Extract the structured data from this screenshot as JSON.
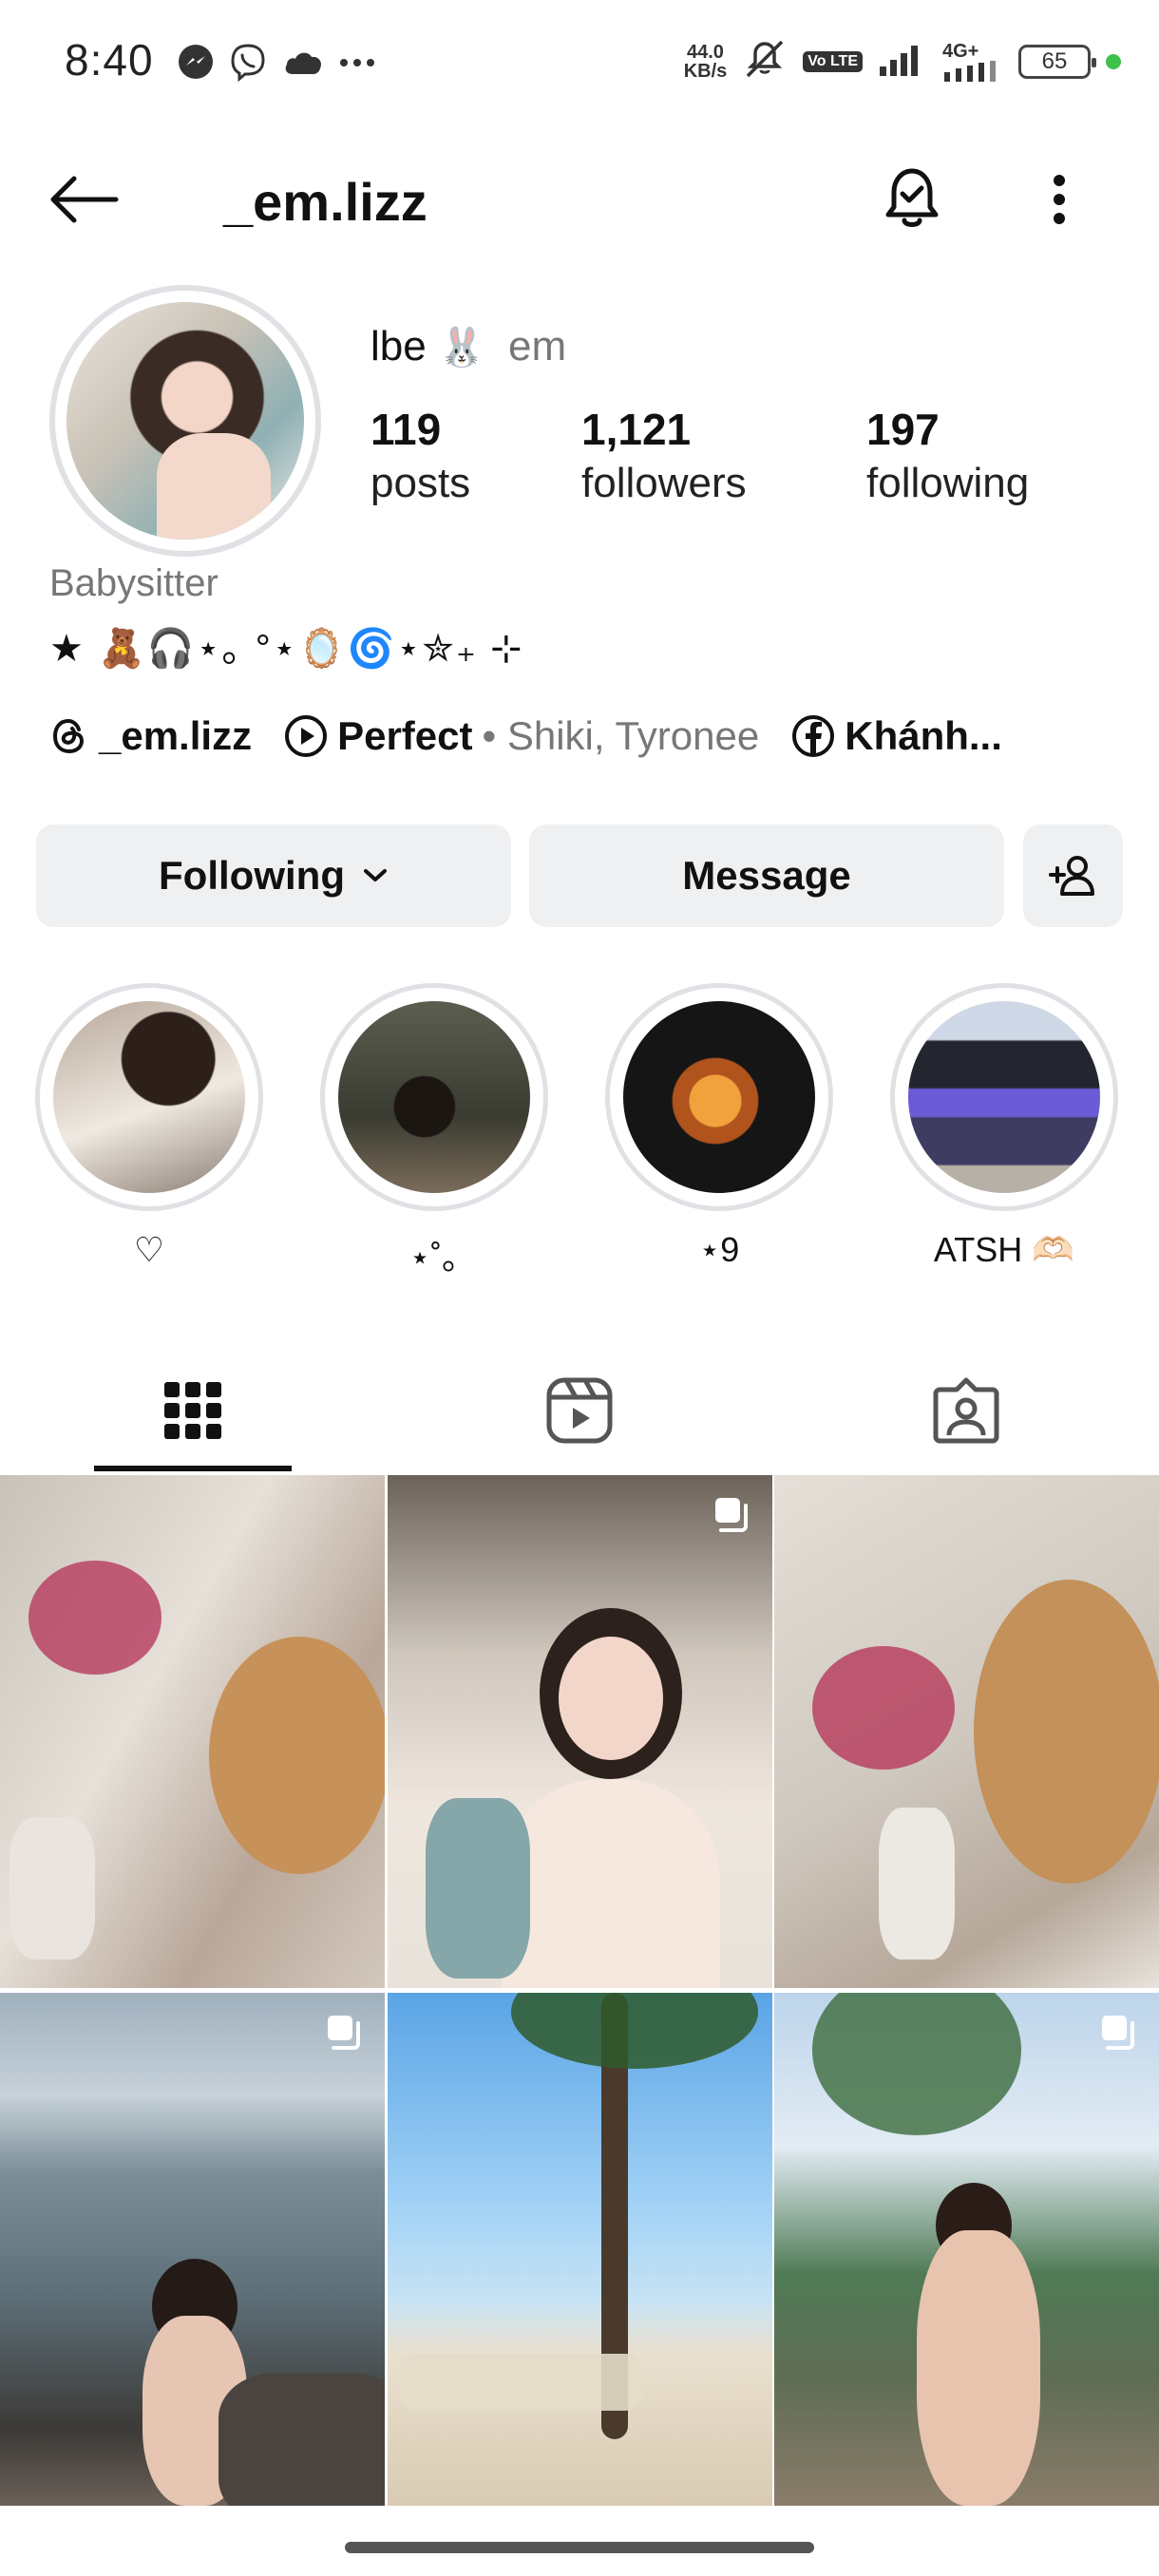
{
  "status_bar": {
    "time": "8:40",
    "net_speed_value": "44.0",
    "net_speed_unit": "KB/s",
    "volte": "Vo LTE",
    "network": "4G+",
    "battery": "65",
    "icons": [
      "messenger-icon",
      "viber-icon",
      "cloud-icon",
      "more-dots-icon",
      "mute-icon",
      "signal-icon",
      "wifi-icon"
    ]
  },
  "header": {
    "username": "_em.lizz"
  },
  "profile": {
    "display_name": "lbe",
    "name_emoji": "🐰",
    "pronoun": "em",
    "stats": [
      {
        "count": "119",
        "label": "posts"
      },
      {
        "count": "1,121",
        "label": "followers"
      },
      {
        "count": "197",
        "label": "following"
      }
    ],
    "category": "Babysitter",
    "bio": "★ 🧸🎧⋆｡ °⋆🪞🌀⋆✮₊ ⊹"
  },
  "links": {
    "threads": "_em.lizz",
    "music_title": "Perfect",
    "music_artist": "• Shiki, Tyronee",
    "facebook": "Khánh..."
  },
  "actions": {
    "following": "Following",
    "message": "Message"
  },
  "highlights": [
    {
      "label": "♡"
    },
    {
      "label": "⋆˚｡"
    },
    {
      "label": "⋆9"
    },
    {
      "label": "ATSH 🫶🏻"
    }
  ],
  "tabs": [
    "posts-grid",
    "reels",
    "tagged"
  ]
}
